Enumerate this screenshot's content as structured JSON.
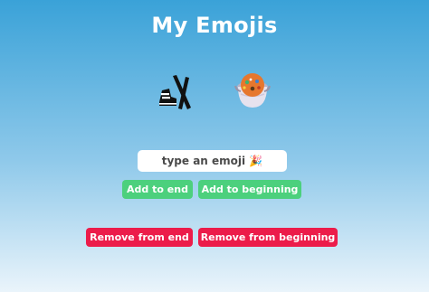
{
  "header": {
    "title": "My Emojis"
  },
  "emojis": [
    {
      "name": "ski-boot-icon"
    },
    {
      "name": "soup-bowl-icon"
    }
  ],
  "input": {
    "placeholder": "type an emoji 🎉",
    "value": ""
  },
  "buttons": {
    "add_to_end": "Add to end",
    "add_to_beginning": "Add to beginning",
    "remove_from_end": "Remove from end",
    "remove_from_beginning": "Remove from beginning"
  },
  "colors": {
    "add_button": "#4cd07d",
    "remove_button": "#ec1c4a",
    "background_top": "#3aa2d8",
    "background_bottom": "#eaf4fb"
  }
}
